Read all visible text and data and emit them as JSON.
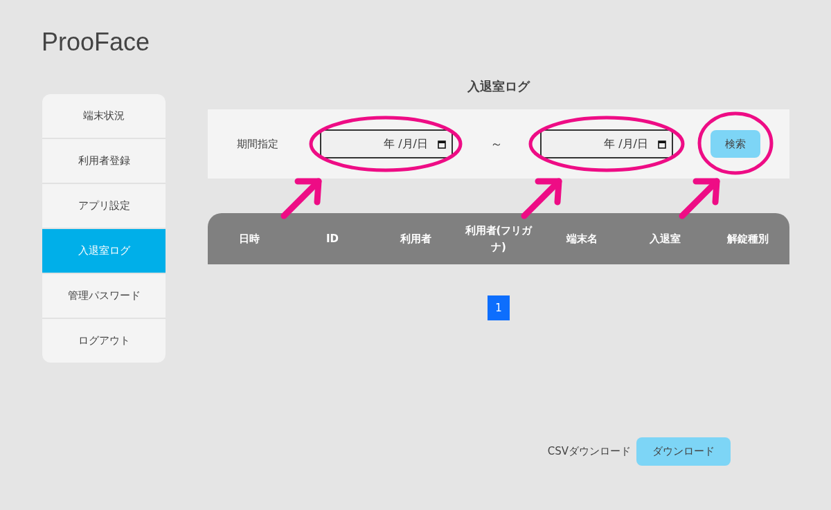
{
  "logo": "ProoFace",
  "sidebar": {
    "items": [
      {
        "label": "端末状況",
        "selected": false
      },
      {
        "label": "利用者登録",
        "selected": false
      },
      {
        "label": "アプリ設定",
        "selected": false
      },
      {
        "label": "入退室ログ",
        "selected": true
      },
      {
        "label": "管理パスワード",
        "selected": false
      },
      {
        "label": "ログアウト",
        "selected": false
      }
    ]
  },
  "page_title": "入退室ログ",
  "filter": {
    "label": "期間指定",
    "from": {
      "value": "年 /月/日"
    },
    "separator": "～",
    "to": {
      "value": "年 /月/日"
    },
    "search_button": "検索"
  },
  "table": {
    "columns": [
      "日時",
      "ID",
      "利用者",
      "利用者(フリガナ)",
      "端末名",
      "入退室",
      "解錠種別"
    ]
  },
  "pagination": [
    {
      "label": "1",
      "selected": true
    }
  ],
  "csv": {
    "label": "CSVダウンロード",
    "button": "ダウンロード"
  }
}
